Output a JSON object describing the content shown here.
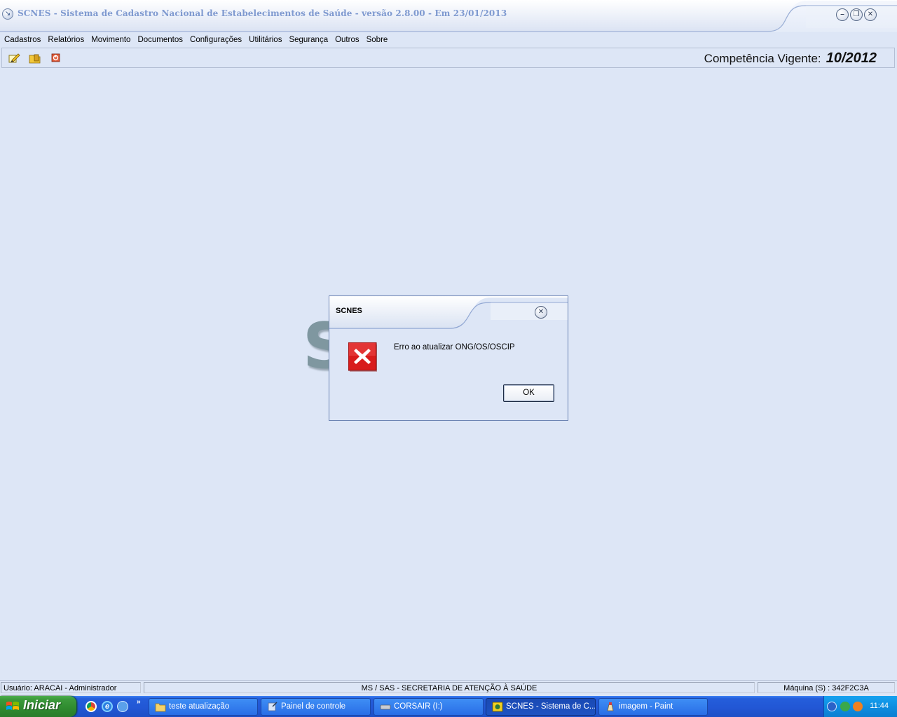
{
  "window": {
    "title": "SCNES - Sistema de Cadastro Nacional de Estabelecimentos de Saúde - versão 2.8.00  -  Em 23/01/2013",
    "sys_icon": "↘",
    "minimize": "–",
    "restore": "❐",
    "close": "✕"
  },
  "menu": {
    "items": [
      "Cadastros",
      "Relatórios",
      "Movimento",
      "Documentos",
      "Configurações",
      "Utilitários",
      "Segurança",
      "Outros",
      "Sobre"
    ]
  },
  "toolbar": {
    "icons": [
      "edit-icon",
      "folder-icon",
      "exit-icon"
    ],
    "competencia_label": "Competência Vigente:",
    "competencia_value": "10/2012"
  },
  "background": {
    "logo_letter": "S"
  },
  "dialog": {
    "title": "SCNES",
    "close": "✕",
    "message": "Erro ao atualizar ONG/OS/OSCIP",
    "ok_label": "OK",
    "icon": "error-icon"
  },
  "statusbar": {
    "user": "Usuário: ARACAI - Administrador",
    "org": "MS / SAS - SECRETARIA DE ATENÇÃO À SAÚDE",
    "machine": "Máquina (S) : 342F2C3A"
  },
  "taskbar": {
    "start_label": "Iniciar",
    "more": "»",
    "tasks": [
      {
        "label": "teste atualização"
      },
      {
        "label": "Painel de controle"
      },
      {
        "label": "CORSAIR (I:)"
      },
      {
        "label": "SCNES - Sistema de C..."
      },
      {
        "label": "imagem - Paint"
      }
    ],
    "clock": "11:44"
  }
}
